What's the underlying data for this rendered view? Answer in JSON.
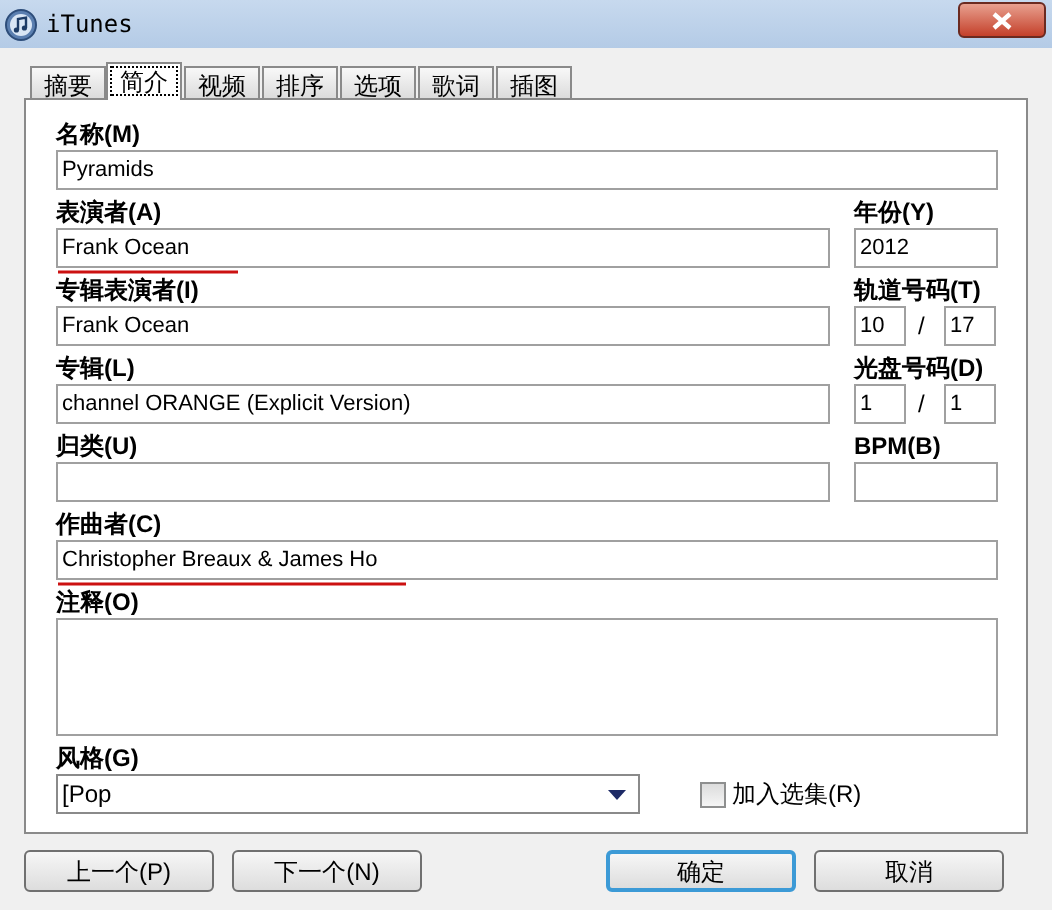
{
  "window": {
    "title": "iTunes"
  },
  "tabs": [
    {
      "label": "摘要",
      "selected": false
    },
    {
      "label": "简介",
      "selected": true
    },
    {
      "label": "视频",
      "selected": false
    },
    {
      "label": "排序",
      "selected": false
    },
    {
      "label": "选项",
      "selected": false
    },
    {
      "label": "歌词",
      "selected": false
    },
    {
      "label": "插图",
      "selected": false
    }
  ],
  "name": {
    "label": "名称(M)",
    "value": "Pyramids"
  },
  "artist": {
    "label": "表演者(A)",
    "value": "Frank Ocean",
    "annotated": true
  },
  "year": {
    "label": "年份(Y)",
    "value": "2012"
  },
  "album_artist": {
    "label": "专辑表演者(I)",
    "value": "Frank Ocean"
  },
  "track": {
    "label": "轨道号码(T)",
    "number": "10",
    "separator": "/",
    "total": "17"
  },
  "album": {
    "label": "专辑(L)",
    "value": "channel ORANGE (Explicit Version)"
  },
  "disc": {
    "label": "光盘号码(D)",
    "number": "1",
    "separator": "/",
    "total": "1"
  },
  "grouping": {
    "label": "归类(U)"
  },
  "bpm": {
    "label": "BPM(B)"
  },
  "composer": {
    "label": "作曲者(C)",
    "value": "Christopher Breaux & James Ho",
    "annotated": true
  },
  "comments": {
    "label": "注释(O)"
  },
  "genre": {
    "label": "风格(G)",
    "value": "[Pop"
  },
  "compilation": {
    "label": "加入选集(R)",
    "checked": false
  },
  "buttons": [
    {
      "label": "上一个(P)",
      "default": false
    },
    {
      "label": "下一个(N)",
      "default": false
    },
    {
      "label": "确定",
      "default": true
    },
    {
      "label": "取消",
      "default": false
    }
  ]
}
